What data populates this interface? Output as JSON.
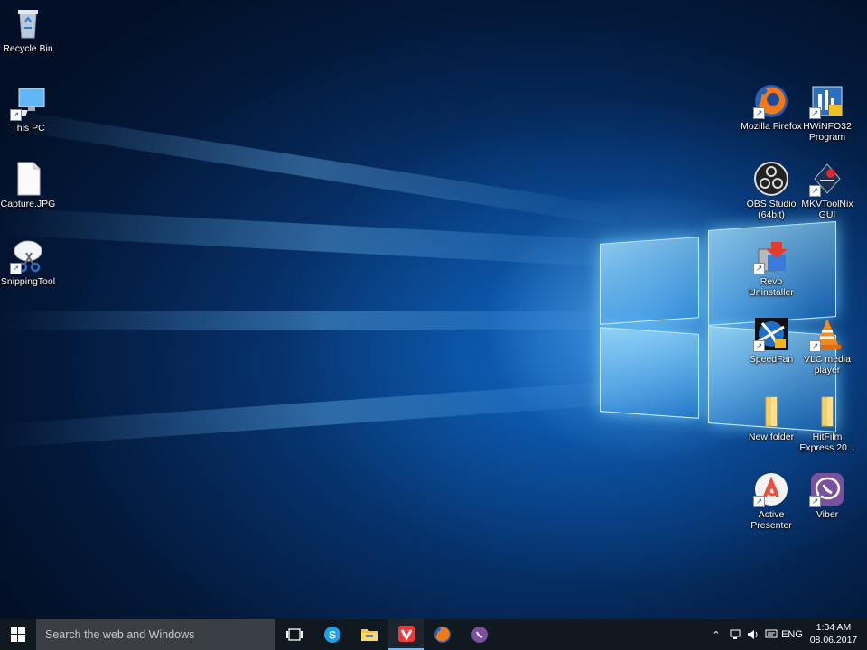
{
  "desktop": {
    "left_icons": [
      {
        "label": "Recycle Bin",
        "icon": "recycle-bin-icon"
      },
      {
        "label": "This PC",
        "icon": "computer-icon"
      },
      {
        "label": "Capture.JPG",
        "icon": "image-file-icon"
      },
      {
        "label": "SnippingTool",
        "icon": "scissors-icon"
      }
    ],
    "right_icons": [
      {
        "label": "Mozilla Firefox",
        "icon": "firefox-icon"
      },
      {
        "label": "HWiNFO32 Program",
        "icon": "hwinfo-icon"
      },
      {
        "label": "OBS Studio (64bit)",
        "icon": "obs-icon"
      },
      {
        "label": "MKVToolNix GUI",
        "icon": "mkvtoolnix-icon"
      },
      {
        "label": "Revo Uninstaller",
        "icon": "revo-icon"
      },
      {
        "label": "SpeedFan",
        "icon": "speedfan-icon"
      },
      {
        "label": "VLC media player",
        "icon": "vlc-icon"
      },
      {
        "label": "New folder",
        "icon": "folder-icon"
      },
      {
        "label": "HitFilm Express 20...",
        "icon": "folder-icon"
      },
      {
        "label": "Active Presenter",
        "icon": "active-presenter-icon"
      },
      {
        "label": "Viber",
        "icon": "viber-icon"
      }
    ]
  },
  "taskbar": {
    "search_placeholder": "Search the web and Windows",
    "pinned": [
      "task-view-icon",
      "skype-icon",
      "file-explorer-icon",
      "vivaldi-icon",
      "firefox-icon",
      "viber-icon"
    ],
    "language": "ENG",
    "time": "1:34 AM",
    "date": "08.06.2017"
  },
  "colors": {
    "taskbar": "#101820",
    "search": "#3a3f45",
    "accent": "#7ab5f0"
  }
}
